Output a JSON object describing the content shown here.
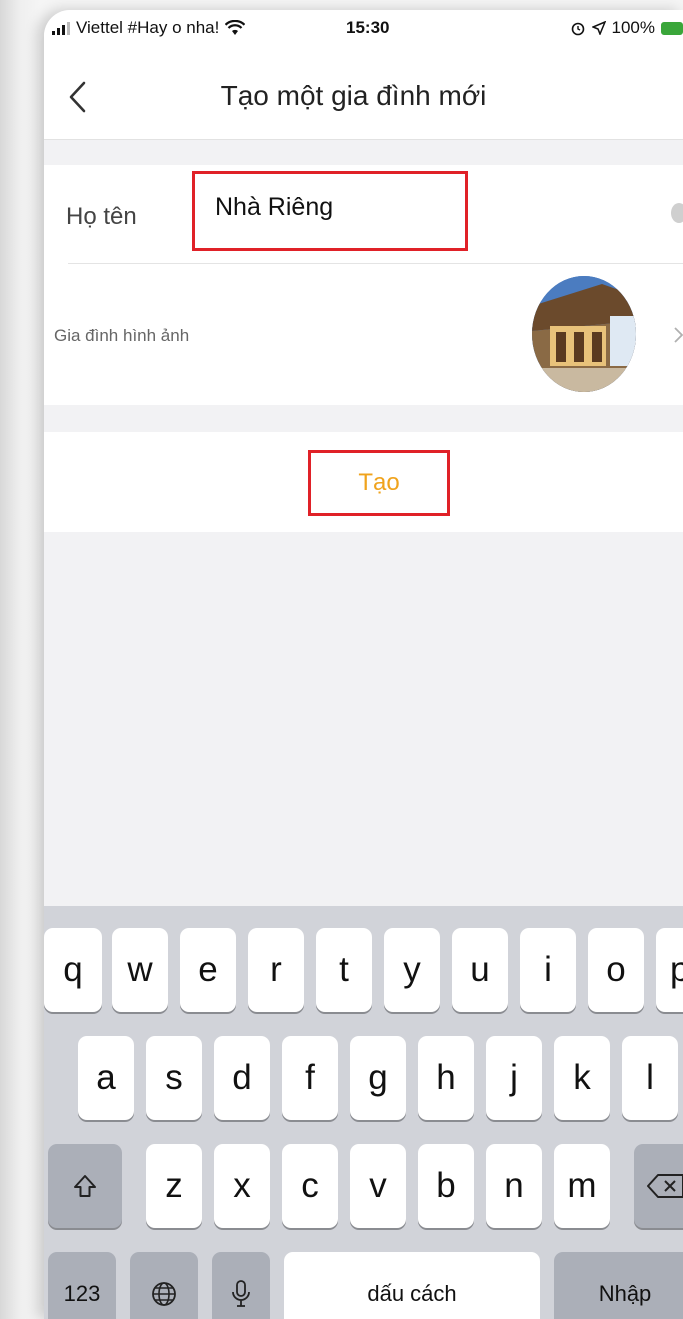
{
  "status_bar": {
    "carrier": "Viettel #Hay o nha!",
    "time": "15:30",
    "battery": "100%",
    "icons": [
      "signal-icon",
      "wifi-icon",
      "alarm-icon",
      "location-icon",
      "battery-icon"
    ]
  },
  "nav": {
    "title": "Tạo một gia đình mới",
    "back_icon": "chevron-left-icon"
  },
  "form": {
    "name_label": "Họ tên",
    "name_value": "Nhà Riêng",
    "photo_label": "Gia đình hình ảnh"
  },
  "actions": {
    "create_label": "Tạo"
  },
  "keyboard": {
    "row1": [
      "q",
      "w",
      "e",
      "r",
      "t",
      "y",
      "u",
      "i",
      "o",
      "p"
    ],
    "row2": [
      "a",
      "s",
      "d",
      "f",
      "g",
      "h",
      "j",
      "k",
      "l"
    ],
    "row3": [
      "z",
      "x",
      "c",
      "v",
      "b",
      "n",
      "m"
    ],
    "numbers_label": "123",
    "space_label": "dấu cách",
    "return_label": "Nhập",
    "icons": [
      "shift-icon",
      "backspace-icon",
      "globe-icon",
      "microphone-icon"
    ]
  },
  "colors": {
    "accent": "#f0a31c",
    "highlight_box": "#e02128"
  }
}
